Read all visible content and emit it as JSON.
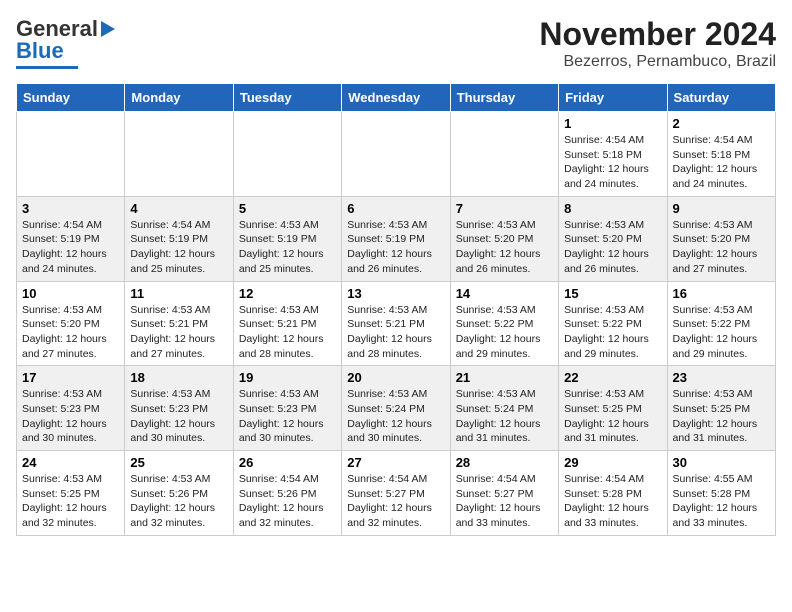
{
  "logo": {
    "text1": "General",
    "text2": "Blue"
  },
  "title": "November 2024",
  "location": "Bezerros, Pernambuco, Brazil",
  "weekdays": [
    "Sunday",
    "Monday",
    "Tuesday",
    "Wednesday",
    "Thursday",
    "Friday",
    "Saturday"
  ],
  "weeks": [
    [
      {
        "day": "",
        "info": ""
      },
      {
        "day": "",
        "info": ""
      },
      {
        "day": "",
        "info": ""
      },
      {
        "day": "",
        "info": ""
      },
      {
        "day": "",
        "info": ""
      },
      {
        "day": "1",
        "info": "Sunrise: 4:54 AM\nSunset: 5:18 PM\nDaylight: 12 hours and 24 minutes."
      },
      {
        "day": "2",
        "info": "Sunrise: 4:54 AM\nSunset: 5:18 PM\nDaylight: 12 hours and 24 minutes."
      }
    ],
    [
      {
        "day": "3",
        "info": "Sunrise: 4:54 AM\nSunset: 5:19 PM\nDaylight: 12 hours and 24 minutes."
      },
      {
        "day": "4",
        "info": "Sunrise: 4:54 AM\nSunset: 5:19 PM\nDaylight: 12 hours and 25 minutes."
      },
      {
        "day": "5",
        "info": "Sunrise: 4:53 AM\nSunset: 5:19 PM\nDaylight: 12 hours and 25 minutes."
      },
      {
        "day": "6",
        "info": "Sunrise: 4:53 AM\nSunset: 5:19 PM\nDaylight: 12 hours and 26 minutes."
      },
      {
        "day": "7",
        "info": "Sunrise: 4:53 AM\nSunset: 5:20 PM\nDaylight: 12 hours and 26 minutes."
      },
      {
        "day": "8",
        "info": "Sunrise: 4:53 AM\nSunset: 5:20 PM\nDaylight: 12 hours and 26 minutes."
      },
      {
        "day": "9",
        "info": "Sunrise: 4:53 AM\nSunset: 5:20 PM\nDaylight: 12 hours and 27 minutes."
      }
    ],
    [
      {
        "day": "10",
        "info": "Sunrise: 4:53 AM\nSunset: 5:20 PM\nDaylight: 12 hours and 27 minutes."
      },
      {
        "day": "11",
        "info": "Sunrise: 4:53 AM\nSunset: 5:21 PM\nDaylight: 12 hours and 27 minutes."
      },
      {
        "day": "12",
        "info": "Sunrise: 4:53 AM\nSunset: 5:21 PM\nDaylight: 12 hours and 28 minutes."
      },
      {
        "day": "13",
        "info": "Sunrise: 4:53 AM\nSunset: 5:21 PM\nDaylight: 12 hours and 28 minutes."
      },
      {
        "day": "14",
        "info": "Sunrise: 4:53 AM\nSunset: 5:22 PM\nDaylight: 12 hours and 29 minutes."
      },
      {
        "day": "15",
        "info": "Sunrise: 4:53 AM\nSunset: 5:22 PM\nDaylight: 12 hours and 29 minutes."
      },
      {
        "day": "16",
        "info": "Sunrise: 4:53 AM\nSunset: 5:22 PM\nDaylight: 12 hours and 29 minutes."
      }
    ],
    [
      {
        "day": "17",
        "info": "Sunrise: 4:53 AM\nSunset: 5:23 PM\nDaylight: 12 hours and 30 minutes."
      },
      {
        "day": "18",
        "info": "Sunrise: 4:53 AM\nSunset: 5:23 PM\nDaylight: 12 hours and 30 minutes."
      },
      {
        "day": "19",
        "info": "Sunrise: 4:53 AM\nSunset: 5:23 PM\nDaylight: 12 hours and 30 minutes."
      },
      {
        "day": "20",
        "info": "Sunrise: 4:53 AM\nSunset: 5:24 PM\nDaylight: 12 hours and 30 minutes."
      },
      {
        "day": "21",
        "info": "Sunrise: 4:53 AM\nSunset: 5:24 PM\nDaylight: 12 hours and 31 minutes."
      },
      {
        "day": "22",
        "info": "Sunrise: 4:53 AM\nSunset: 5:25 PM\nDaylight: 12 hours and 31 minutes."
      },
      {
        "day": "23",
        "info": "Sunrise: 4:53 AM\nSunset: 5:25 PM\nDaylight: 12 hours and 31 minutes."
      }
    ],
    [
      {
        "day": "24",
        "info": "Sunrise: 4:53 AM\nSunset: 5:25 PM\nDaylight: 12 hours and 32 minutes."
      },
      {
        "day": "25",
        "info": "Sunrise: 4:53 AM\nSunset: 5:26 PM\nDaylight: 12 hours and 32 minutes."
      },
      {
        "day": "26",
        "info": "Sunrise: 4:54 AM\nSunset: 5:26 PM\nDaylight: 12 hours and 32 minutes."
      },
      {
        "day": "27",
        "info": "Sunrise: 4:54 AM\nSunset: 5:27 PM\nDaylight: 12 hours and 32 minutes."
      },
      {
        "day": "28",
        "info": "Sunrise: 4:54 AM\nSunset: 5:27 PM\nDaylight: 12 hours and 33 minutes."
      },
      {
        "day": "29",
        "info": "Sunrise: 4:54 AM\nSunset: 5:28 PM\nDaylight: 12 hours and 33 minutes."
      },
      {
        "day": "30",
        "info": "Sunrise: 4:55 AM\nSunset: 5:28 PM\nDaylight: 12 hours and 33 minutes."
      }
    ]
  ]
}
